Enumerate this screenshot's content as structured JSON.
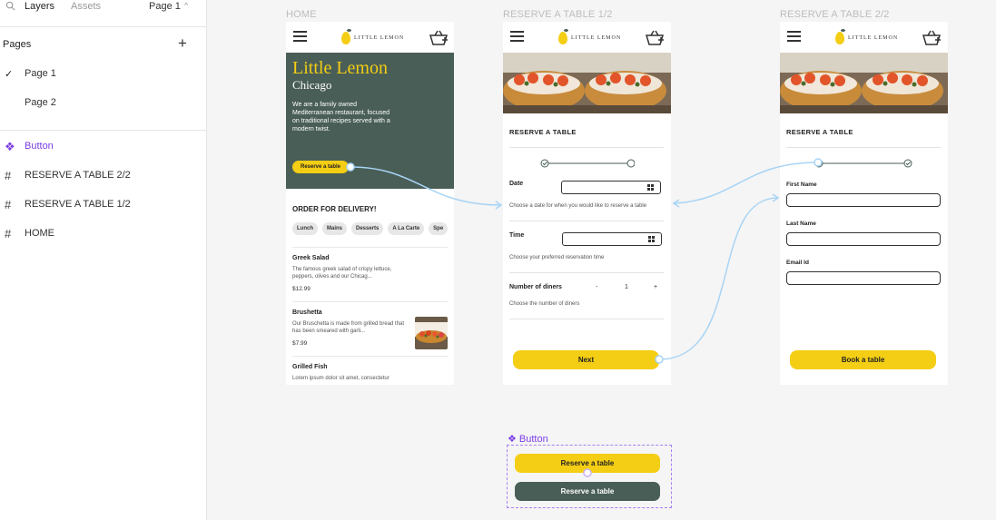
{
  "layers_panel": {
    "tab_layers": "Layers",
    "tab_assets": "Assets",
    "page_selector": "Page 1",
    "pages_header": "Pages",
    "pages": [
      "Page 1",
      "Page 2"
    ],
    "layers": [
      {
        "icon": "component-icon",
        "label": "Button"
      },
      {
        "icon": "frame-icon",
        "label": "RESERVE A TABLE 2/2"
      },
      {
        "icon": "frame-icon",
        "label": "RESERVE A TABLE 1/2"
      },
      {
        "icon": "frame-icon",
        "label": "HOME"
      }
    ]
  },
  "frames": {
    "home_label": "HOME",
    "reserve1_label": "RESERVE A TABLE 1/2",
    "reserve2_label": "RESERVE A TABLE 2/2"
  },
  "brand": {
    "logo_text": "LITTLE LEMON",
    "yellow": "#f4ce14",
    "green": "#495e57"
  },
  "home": {
    "title": "Little Lemon",
    "city": "Chicago",
    "description": "We are a family owned Mediterranean restaurant, focused on traditional recipes served with a modern twist.",
    "reserve_button": "Reserve a table",
    "order_title": "ORDER FOR DELIVERY!",
    "categories": [
      "Lunch",
      "Mains",
      "Desserts",
      "A La Carte",
      "Spe"
    ],
    "menu": [
      {
        "name": "Greek Salad",
        "desc": "The famous greek salad of crispy lettuce, peppers, olives and our Chicag...",
        "price": "$12.99"
      },
      {
        "name": "Brushetta",
        "desc": "Our Bruschetta is made from grilled bread that has been smeared with garli...",
        "price": "$7.99"
      },
      {
        "name": "Grilled Fish",
        "desc": "Lorem ipsum dolor sit amet, consectetur",
        "price": ""
      }
    ]
  },
  "reserve1": {
    "section_title": "RESERVE A TABLE",
    "date_label": "Date",
    "date_hint": "Choose a date for when you would like to reserve a table",
    "time_label": "Time",
    "time_hint": "Choose your preferred reservation time",
    "diners_label": "Number of diners",
    "diners_minus": "-",
    "diners_value": "1",
    "diners_plus": "+",
    "diners_hint": "Choose the number of diners",
    "next_button": "Next"
  },
  "reserve2": {
    "section_title": "RESERVE A TABLE",
    "first_name_label": "First Name",
    "last_name_label": "Last Name",
    "email_label": "Email Id",
    "book_button": "Book a table"
  },
  "component": {
    "label": "Button",
    "variant_primary": "Reserve a table",
    "variant_secondary": "Reserve a table"
  }
}
